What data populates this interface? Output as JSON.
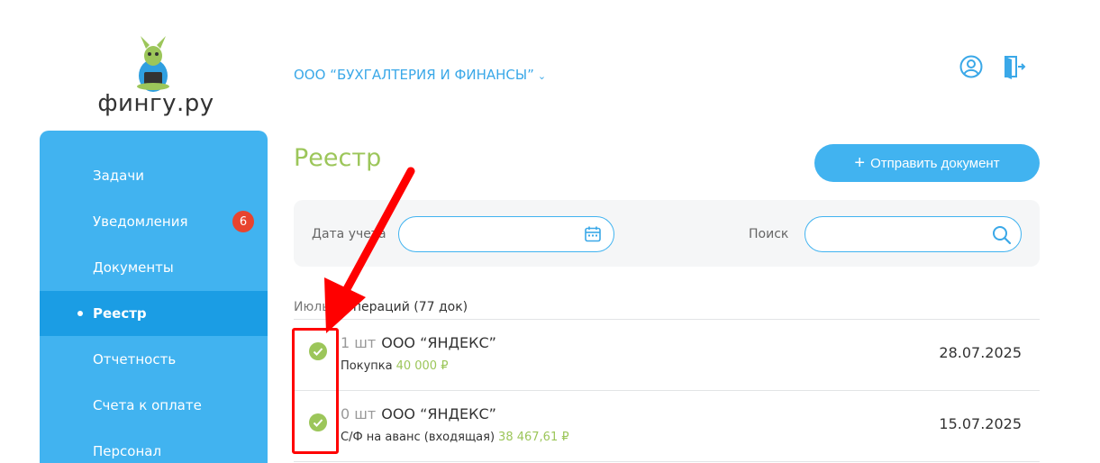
{
  "logo": {
    "text": "фингу.ру"
  },
  "header": {
    "company": "ООО “БУХГАЛТЕРИЯ И ФИНАНСЫ”"
  },
  "sidebar": {
    "items": [
      {
        "label": "Задачи"
      },
      {
        "label": "Уведомления",
        "badge": "6"
      },
      {
        "label": "Документы"
      },
      {
        "label": "Реестр",
        "active": true
      },
      {
        "label": "Отчетность"
      },
      {
        "label": "Счета к оплате"
      },
      {
        "label": "Персонал"
      }
    ]
  },
  "main": {
    "title": "Реестр",
    "send_button": "Отправить документ",
    "filters": {
      "date_label": "Дата учета",
      "date_value": "",
      "search_label": "Поиск",
      "search_value": ""
    },
    "month_prefix": "Июль",
    "month_summary": "0 операций (77 док)",
    "rows": [
      {
        "qty": "1 шт",
        "company": "ООО “ЯНДЕКС”",
        "type": "Покупка",
        "amount": "40 000 ₽",
        "date": "28.07.2025"
      },
      {
        "qty": "0 шт",
        "company": "ООО “ЯНДЕКС”",
        "type": "С/Ф на аванс (входящая)",
        "amount": "38 467,61 ₽",
        "date": "15.07.2025"
      }
    ]
  },
  "colors": {
    "accent_blue": "#41b3f0",
    "active_blue": "#1b9de4",
    "green": "#9cc65a",
    "badge_red": "#e8442f",
    "annotation_red": "#ff0000"
  }
}
